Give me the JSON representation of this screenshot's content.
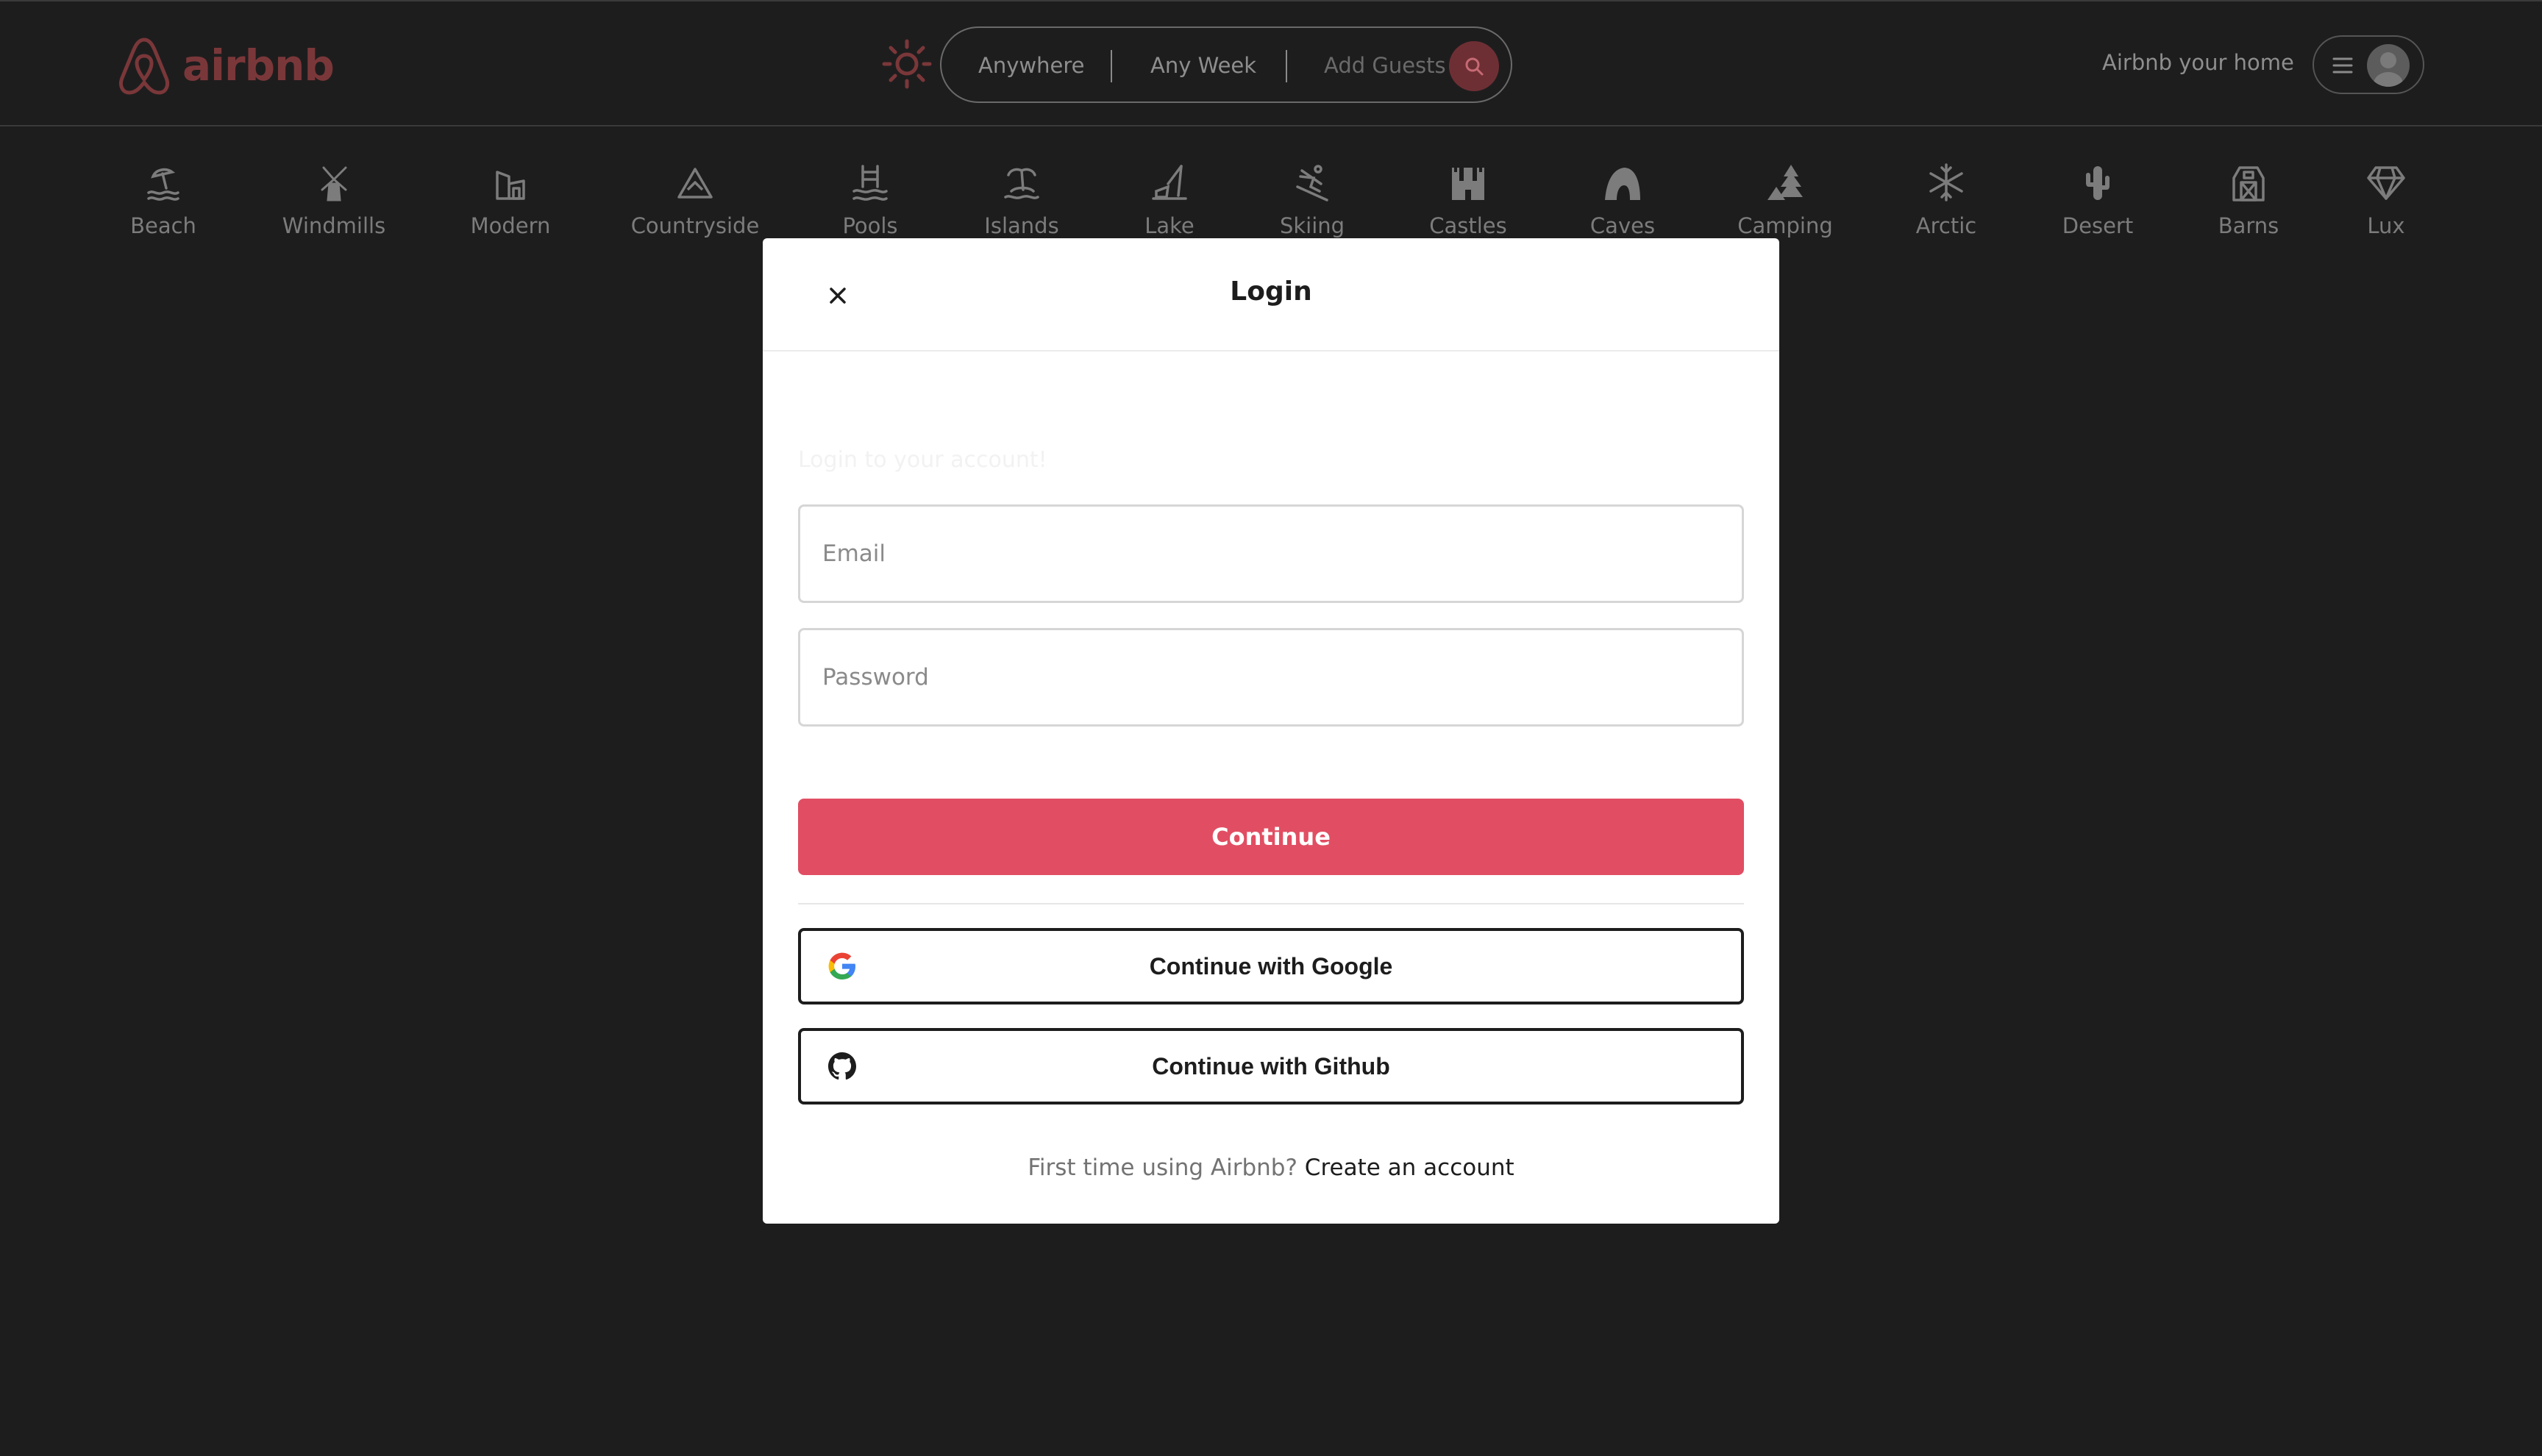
{
  "navbar": {
    "logo_text": "airbnb",
    "brand_color": "#7a3739",
    "theme_toggle_icon": "sun-icon",
    "search": {
      "anywhere": "Anywhere",
      "any_week": "Any Week",
      "add_guests": "Add Guests",
      "button_icon": "search-icon"
    },
    "host_link": "Airbnb your home",
    "user_menu_icon": "hamburger-icon"
  },
  "categories": [
    {
      "label": "Beach",
      "icon": "beach-icon"
    },
    {
      "label": "Windmills",
      "icon": "windmill-icon"
    },
    {
      "label": "Modern",
      "icon": "modern-house-icon"
    },
    {
      "label": "Countryside",
      "icon": "mountain-icon"
    },
    {
      "label": "Pools",
      "icon": "pool-icon"
    },
    {
      "label": "Islands",
      "icon": "island-icon"
    },
    {
      "label": "Lake",
      "icon": "lake-icon"
    },
    {
      "label": "Skiing",
      "icon": "skiing-icon"
    },
    {
      "label": "Castles",
      "icon": "castle-icon"
    },
    {
      "label": "Caves",
      "icon": "cave-icon"
    },
    {
      "label": "Camping",
      "icon": "camping-icon"
    },
    {
      "label": "Arctic",
      "icon": "snowflake-icon"
    },
    {
      "label": "Desert",
      "icon": "cactus-icon"
    },
    {
      "label": "Barns",
      "icon": "barn-icon"
    },
    {
      "label": "Lux",
      "icon": "diamond-icon"
    }
  ],
  "modal": {
    "title": "Login",
    "subtitle": "Login to your account!",
    "email_placeholder": "Email",
    "password_placeholder": "Password",
    "continue_label": "Continue",
    "google_label": "Continue with Google",
    "github_label": "Continue with Github",
    "signup_prompt": "First time using Airbnb?",
    "signup_link": "Create an account",
    "accent_color": "#e14e63"
  }
}
